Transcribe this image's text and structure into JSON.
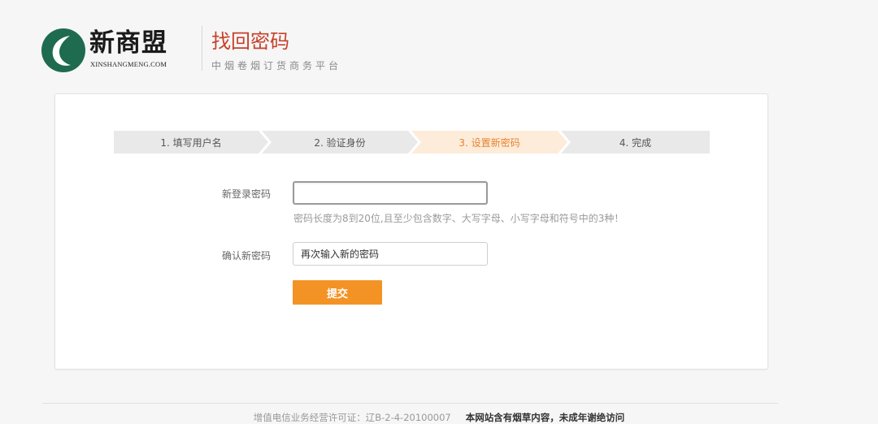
{
  "header": {
    "logo_name": "新商盟",
    "logo_domain": "XINSHANGMENG.COM",
    "title": "找回密码",
    "subtitle": "中烟卷烟订货商务平台"
  },
  "steps": [
    {
      "label": "1. 填写用户名",
      "active": false
    },
    {
      "label": "2. 验证身份",
      "active": false
    },
    {
      "label": "3. 设置新密码",
      "active": true
    },
    {
      "label": "4. 完成",
      "active": false
    }
  ],
  "form": {
    "new_password_label": "新登录密码",
    "new_password_value": "",
    "password_hint": "密码长度为8到20位,且至少包含数字、大写字母、小写字母和符号中的3种！",
    "confirm_label": "确认新密码",
    "confirm_placeholder": "再次输入新的密码",
    "submit_label": "提交"
  },
  "footer": {
    "license": "增值电信业务经营许可证：辽B-2-4-20100007",
    "warning": "本网站含有烟草内容，未成年谢绝访问"
  },
  "colors": {
    "brand_green": "#1f6b4f",
    "title_red": "#c7412b",
    "active_step_bg": "#fdecd9",
    "active_step_text": "#e8822f",
    "button_orange": "#f39325"
  }
}
